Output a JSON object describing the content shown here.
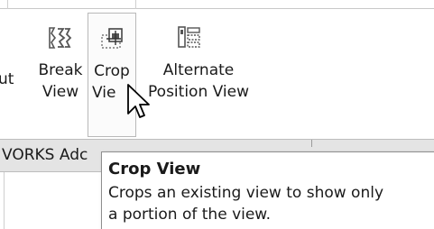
{
  "ribbon": {
    "cut_label_fragment": "ut",
    "commands": [
      {
        "id": "break-view",
        "line1": "Break",
        "line2": "View",
        "icon": "break-view-icon"
      },
      {
        "id": "crop-view",
        "line1": "Crop",
        "line2": "Vie",
        "icon": "crop-view-icon",
        "state": "hovered"
      },
      {
        "id": "alternate-position-view",
        "line1": "Alternate",
        "line2": "Position View",
        "icon": "alternate-position-view-icon"
      }
    ]
  },
  "tabs": {
    "active_label": "VORKS Adc"
  },
  "tooltip": {
    "title": "Crop View",
    "line1": "Crops an existing view to show only",
    "line2": "a portion of the view."
  },
  "cursor": {
    "icon": "arrow-cursor-icon"
  }
}
